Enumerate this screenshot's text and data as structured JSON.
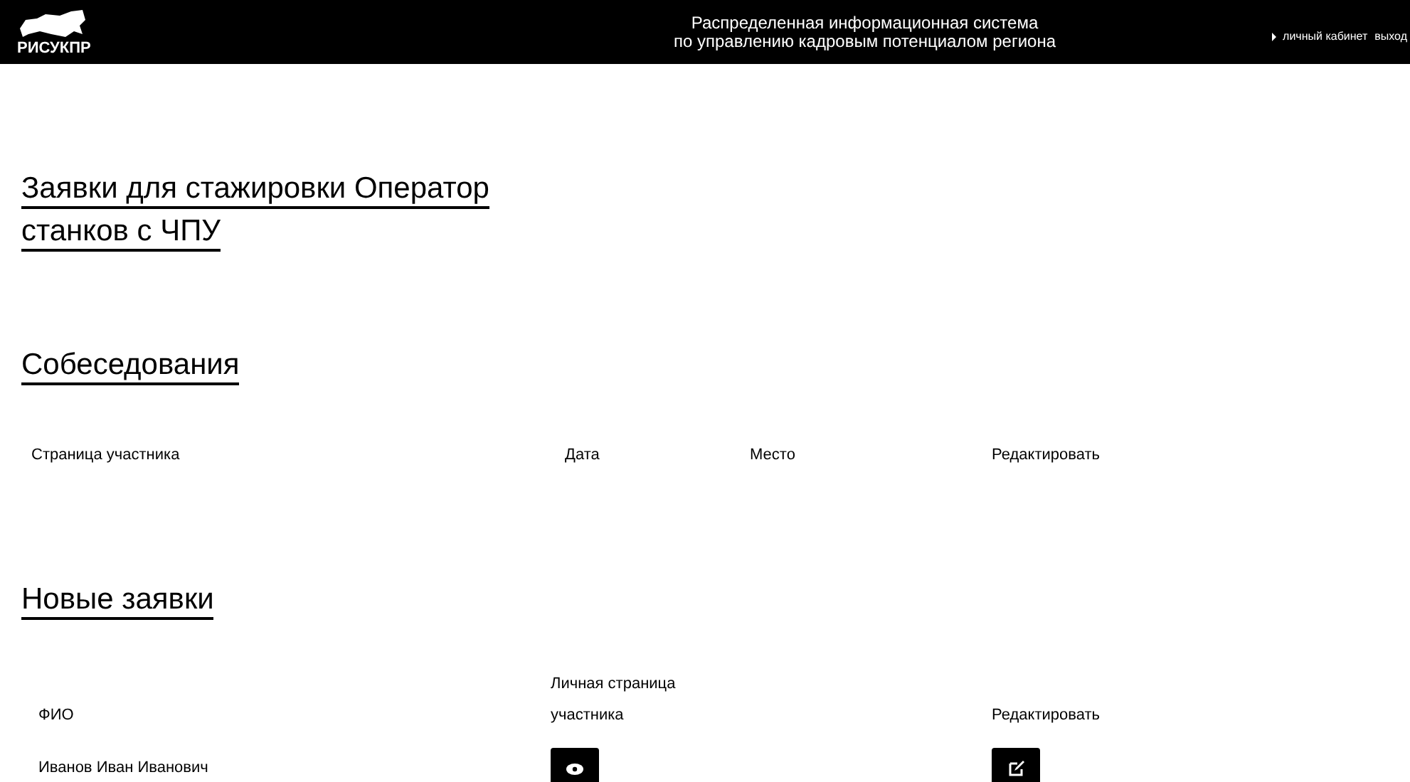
{
  "header": {
    "logo_text": "РИСУКПР",
    "title_lines": [
      "Распределенная информационная система",
      "по управлению кадровым потенциалом региона"
    ],
    "links": [
      "личный кабинет",
      "выход"
    ]
  },
  "page_title_lines": [
    "Заявки для стажировки Оператор",
    "станков с ЧПУ"
  ],
  "interviews": {
    "heading": "Собеседования",
    "columns": [
      "Страница участника",
      "Дата",
      "Место",
      "Редактировать"
    ]
  },
  "new_requests": {
    "heading": "Новые заявки",
    "columns": [
      "ФИО",
      [
        "Личная страница",
        "участника"
      ],
      "Редактировать"
    ],
    "rows": [
      {
        "name": "Иванов Иван Иванович"
      }
    ]
  }
}
